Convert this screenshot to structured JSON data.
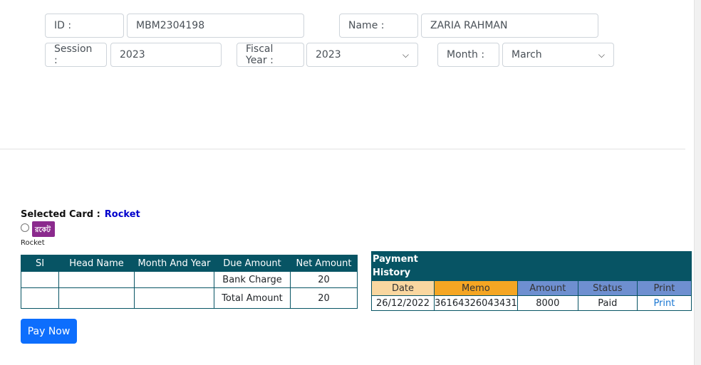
{
  "form": {
    "id_label": "ID :",
    "id_value": "MBM2304198",
    "name_label": "Name :",
    "name_value": "ZARIA RAHMAN",
    "session_label": "Session :",
    "session_value": "2023",
    "fiscal_year_label": "Fiscal Year :",
    "fiscal_year_value": "2023",
    "month_label": "Month :",
    "month_value": "March"
  },
  "card": {
    "selected_label": "Selected Card :",
    "selected_value": "Rocket",
    "option_caption": "Rocket",
    "logo_text": "রকেট"
  },
  "due_table": {
    "headers": [
      "SI",
      "Head Name",
      "Month And Year",
      "Due Amount",
      "Net Amount"
    ],
    "rows": [
      {
        "si": "",
        "head": "",
        "month": "",
        "due": "Bank Charge",
        "net": "20"
      },
      {
        "si": "",
        "head": "",
        "month": "",
        "due": "Total Amount",
        "net": "20"
      }
    ]
  },
  "history_table": {
    "title": "Payment History",
    "headers": [
      "Date",
      "Memo",
      "Amount",
      "Status",
      "Print"
    ],
    "rows": [
      {
        "date": "26/12/2022",
        "memo": "36164326043431",
        "amount": "8000",
        "status": "Paid",
        "print": "Print"
      }
    ]
  },
  "pay_button": "Pay Now",
  "colors": {
    "table_header": "#075464",
    "primary": "#0d6efd",
    "selected_card": "#0000cc",
    "date_col": "#fad7a0",
    "memo_col": "#f5a623",
    "other_cols": "#6e8fd0"
  }
}
